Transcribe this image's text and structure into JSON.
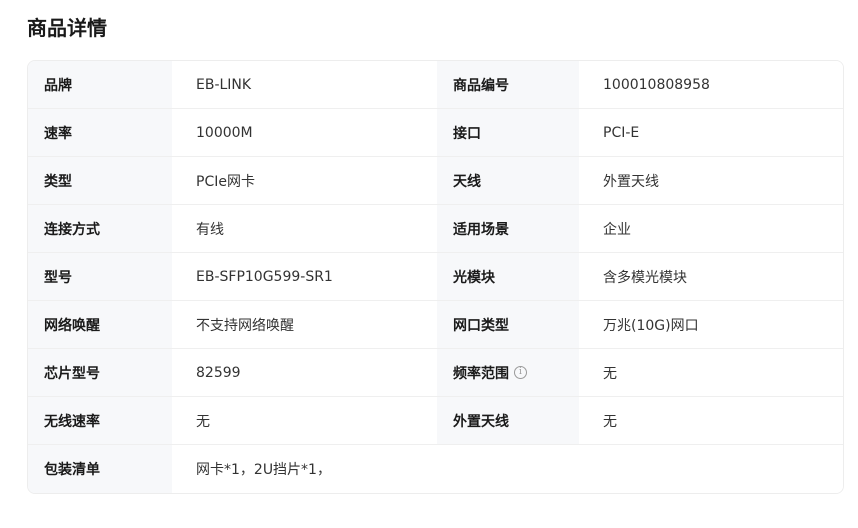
{
  "section": {
    "title": "商品详情"
  },
  "specs": {
    "rows": [
      {
        "label1": "品牌",
        "value1": "EB-LINK",
        "label2": "商品编号",
        "value2": "100010808958"
      },
      {
        "label1": "速率",
        "value1": "10000M",
        "label2": "接口",
        "value2": "PCI-E"
      },
      {
        "label1": "类型",
        "value1": "PCIe网卡",
        "label2": "天线",
        "value2": "外置天线"
      },
      {
        "label1": "连接方式",
        "value1": "有线",
        "label2": "适用场景",
        "value2": "企业"
      },
      {
        "label1": "型号",
        "value1": "EB-SFP10G599-SR1",
        "label2": "光模块",
        "value2": "含多模光模块"
      },
      {
        "label1": "网络唤醒",
        "value1": "不支持网络唤醒",
        "label2": "网口类型",
        "value2": "万兆(10G)网口"
      },
      {
        "label1": "芯片型号",
        "value1": "82599",
        "label2": "频率范围",
        "value2": "无",
        "info_icon": "info-circle-icon"
      },
      {
        "label1": "无线速率",
        "value1": "无",
        "label2": "外置天线",
        "value2": "无"
      }
    ],
    "package": {
      "label": "包装清单",
      "value": "网卡*1，2U挡片*1，"
    }
  }
}
